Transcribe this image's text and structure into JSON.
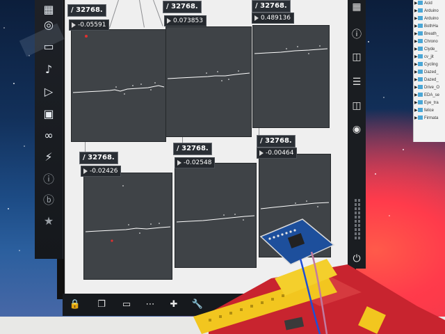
{
  "app": {
    "divisor_label": "/ 32768."
  },
  "plots": [
    {
      "id": "p1",
      "label": "/ 32768.",
      "value": "-0.05591"
    },
    {
      "id": "p2",
      "label": "/ 32768.",
      "value": "0.073853"
    },
    {
      "id": "p3",
      "label": "/ 32768.",
      "value": "0.489136"
    },
    {
      "id": "p4",
      "label": "/ 32768.",
      "value": "-0.02426"
    },
    {
      "id": "p5",
      "label": "/ 32768.",
      "value": "-0.02548"
    },
    {
      "id": "p6",
      "label": "/ 32768.",
      "value": "-0.00464"
    }
  ],
  "left_toolbar": {
    "icons": [
      "cube-icon",
      "target-icon",
      "monitor-icon",
      "music-note-icon",
      "sequence-icon",
      "image-icon",
      "paperclip-icon",
      "plug-icon",
      "info-circle-icon",
      "b-circle-icon",
      "star-icon"
    ]
  },
  "right_toolbar": {
    "icons": [
      "grid-icon",
      "info-icon",
      "panel-icon",
      "list-icon",
      "book-icon",
      "camera-icon",
      "power-icon"
    ]
  },
  "bottom_toolbar": {
    "icons": [
      "lock-icon",
      "windows-icon",
      "presentation-icon",
      "grid-dots-icon",
      "add-object-icon",
      "wrench-icon"
    ]
  },
  "file_list": {
    "items": [
      "Acid",
      "Arduino",
      "Arduino",
      "BothHa",
      "Breath_",
      "Chrono",
      "Clyde_",
      "cv_jit",
      "Cycling",
      "Dazed_",
      "Dazed_",
      "Drive_O",
      "EDA_se",
      "Eye_tra",
      "felice",
      "Firmata"
    ]
  },
  "colors": {
    "plot_bg": "#3f4347",
    "trace": "#ffffff",
    "canvas": "#efefef",
    "toolbar": "#1e2127",
    "pcb": "#c8242f",
    "headers": "#f2c61f"
  }
}
